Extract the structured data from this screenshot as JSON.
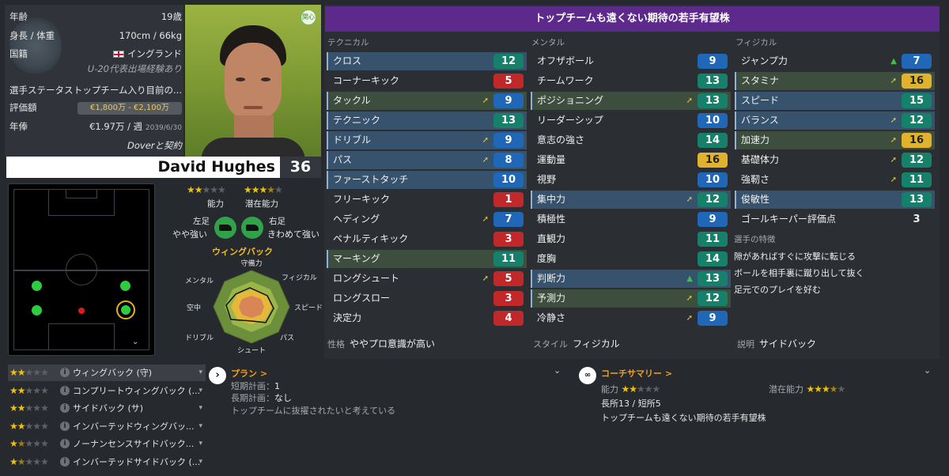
{
  "info": {
    "age_label": "年齢",
    "age": "19歳",
    "height_weight_label": "身長 / 体重",
    "height_weight": "170cm / 66kg",
    "nationality_label": "国籍",
    "nationality": "イングランド",
    "youth_caps": "U-20代表出場経験あり",
    "status_label": "選手ステータス",
    "status": "トップチーム入り目前の...",
    "value_label": "評価額",
    "value": "€1,800万 - €2,100万",
    "wage_label": "年俸",
    "wage": "€1.97万 / 週",
    "contract_end": "2039/6/30",
    "contract": "Doverと契約"
  },
  "portrait": {
    "interest_badge": "関心"
  },
  "player": {
    "name": "David Hughes",
    "number": "36"
  },
  "ratings": {
    "ability_label": "能力",
    "potential_label": "潜在能力",
    "ability_stars": 2,
    "potential_stars": 3.5,
    "left_foot_label": "左足",
    "left_foot": "やや強い",
    "right_foot_label": "右足",
    "right_foot": "きわめて強い",
    "position": "ウィングバック"
  },
  "radar": {
    "labels": [
      "守備力",
      "フィジカル",
      "スピード",
      "パス",
      "シュート",
      "ドリブル",
      "空中",
      "メンタル"
    ]
  },
  "banner": "トップチームも遠くない期待の若手有望株",
  "columns": {
    "technical": "テクニカル",
    "mental": "メンタル",
    "physical": "フィジカル"
  },
  "technical": [
    {
      "name": "クロス",
      "value": "12",
      "color": "teal",
      "hl": "hl",
      "arrow": ""
    },
    {
      "name": "コーナーキック",
      "value": "5",
      "color": "red",
      "hl": "",
      "arrow": ""
    },
    {
      "name": "タックル",
      "value": "9",
      "color": "blue",
      "hl": "gr",
      "arrow": "up"
    },
    {
      "name": "テクニック",
      "value": "13",
      "color": "teal",
      "hl": "hl",
      "arrow": ""
    },
    {
      "name": "ドリブル",
      "value": "9",
      "color": "blue",
      "hl": "hl",
      "arrow": "up"
    },
    {
      "name": "パス",
      "value": "8",
      "color": "blue",
      "hl": "hl",
      "arrow": "up"
    },
    {
      "name": "ファーストタッチ",
      "value": "10",
      "color": "blue",
      "hl": "hl",
      "arrow": ""
    },
    {
      "name": "フリーキック",
      "value": "1",
      "color": "red",
      "hl": "",
      "arrow": ""
    },
    {
      "name": "ヘディング",
      "value": "7",
      "color": "blue",
      "hl": "",
      "arrow": "up"
    },
    {
      "name": "ペナルティキック",
      "value": "3",
      "color": "red",
      "hl": "",
      "arrow": ""
    },
    {
      "name": "マーキング",
      "value": "11",
      "color": "teal",
      "hl": "gr",
      "arrow": ""
    },
    {
      "name": "ロングシュート",
      "value": "5",
      "color": "red",
      "hl": "",
      "arrow": "up"
    },
    {
      "name": "ロングスロー",
      "value": "3",
      "color": "red",
      "hl": "",
      "arrow": ""
    },
    {
      "name": "決定力",
      "value": "4",
      "color": "red",
      "hl": "",
      "arrow": ""
    }
  ],
  "mental": [
    {
      "name": "オフザボール",
      "value": "9",
      "color": "blue",
      "hl": "",
      "arrow": ""
    },
    {
      "name": "チームワーク",
      "value": "13",
      "color": "teal",
      "hl": "",
      "arrow": ""
    },
    {
      "name": "ポジショニング",
      "value": "13",
      "color": "teal",
      "hl": "gr",
      "arrow": "up"
    },
    {
      "name": "リーダーシップ",
      "value": "10",
      "color": "blue",
      "hl": "",
      "arrow": ""
    },
    {
      "name": "意志の強さ",
      "value": "14",
      "color": "teal",
      "hl": "",
      "arrow": ""
    },
    {
      "name": "運動量",
      "value": "16",
      "color": "gold",
      "hl": "",
      "arrow": ""
    },
    {
      "name": "視野",
      "value": "10",
      "color": "blue",
      "hl": "",
      "arrow": ""
    },
    {
      "name": "集中力",
      "value": "12",
      "color": "teal",
      "hl": "hl",
      "arrow": "up"
    },
    {
      "name": "積極性",
      "value": "9",
      "color": "blue",
      "hl": "",
      "arrow": ""
    },
    {
      "name": "直観力",
      "value": "11",
      "color": "teal",
      "hl": "",
      "arrow": ""
    },
    {
      "name": "度胸",
      "value": "14",
      "color": "teal",
      "hl": "",
      "arrow": ""
    },
    {
      "name": "判断力",
      "value": "13",
      "color": "teal",
      "hl": "hl",
      "arrow": "upgreen"
    },
    {
      "name": "予測力",
      "value": "12",
      "color": "teal",
      "hl": "gr",
      "arrow": "up"
    },
    {
      "name": "冷静さ",
      "value": "9",
      "color": "blue",
      "hl": "",
      "arrow": "up"
    }
  ],
  "physical": [
    {
      "name": "ジャンプ力",
      "value": "7",
      "color": "blue",
      "hl": "",
      "arrow": "upgreen"
    },
    {
      "name": "スタミナ",
      "value": "16",
      "color": "gold",
      "hl": "gr",
      "arrow": "up"
    },
    {
      "name": "スピード",
      "value": "15",
      "color": "teal",
      "hl": "hl",
      "arrow": ""
    },
    {
      "name": "バランス",
      "value": "12",
      "color": "teal",
      "hl": "hl",
      "arrow": "up"
    },
    {
      "name": "加速力",
      "value": "16",
      "color": "gold",
      "hl": "gr",
      "arrow": "up"
    },
    {
      "name": "基礎体力",
      "value": "12",
      "color": "teal",
      "hl": "",
      "arrow": "up"
    },
    {
      "name": "強靭さ",
      "value": "11",
      "color": "teal",
      "hl": "",
      "arrow": "up"
    },
    {
      "name": "俊敏性",
      "value": "13",
      "color": "teal",
      "hl": "hl",
      "arrow": ""
    },
    {
      "name": "ゴールキーパー評価点",
      "value": "3",
      "color": "plain",
      "hl": "",
      "arrow": ""
    }
  ],
  "traits": {
    "heading": "選手の特徴",
    "items": [
      "隙があればすぐに攻撃に転じる",
      "ボールを相手裏に蹴り出して抜く",
      "足元でのプレイを好む"
    ]
  },
  "footer": {
    "personality_label": "性格",
    "personality": "ややプロ意識が高い",
    "style_label": "スタイル",
    "style": "フィジカル",
    "desc_label": "説明",
    "desc": "サイドバック"
  },
  "roles": [
    {
      "stars": 2,
      "name": "ウィングバック (守)"
    },
    {
      "stars": 2,
      "name": "コンプリートウィングバック (..."
    },
    {
      "stars": 2,
      "name": "サイドバック (サ)"
    },
    {
      "stars": 2,
      "name": "インバーテッドウィングバッ..."
    },
    {
      "stars": 1.5,
      "name": "ノーナンセンスサイドバック..."
    },
    {
      "stars": 1.5,
      "name": "インバーテッドサイドバック (..."
    }
  ],
  "plan": {
    "title": "プラン >",
    "short_label": "短期計画：",
    "short_value": "1",
    "long_label": "長期計画：",
    "long_value": "なし",
    "note": "トップチームに抜擢されたいと考えている"
  },
  "coach": {
    "title": "コーチサマリー >",
    "ability_label": "能力",
    "potential_label": "潜在能力",
    "strengths": "長所13 / 短所5",
    "summary": "トップチームも遠くない期待の若手有望株"
  }
}
